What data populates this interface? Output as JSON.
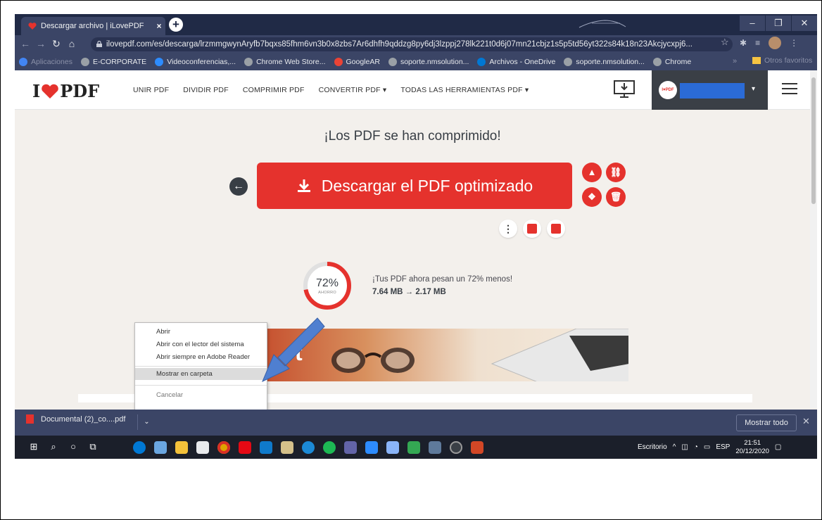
{
  "browser": {
    "tab_title": "Descargar archivo | iLovePDF",
    "tab_close": "×",
    "newtab": "+",
    "window_buttons": [
      "–",
      "❐",
      "✕"
    ],
    "url": "ilovepdf.com/es/descarga/lrzmmgwynAryfb7bqxs85fhm6vn3b0x8zbs7Ar6dhfh9qddzg8py6dj3lzppj278lk221t0d6j07mn21cbjz1s5p5td56yt322s84k18n23Akcjycxpj6..."
  },
  "bookmarks": {
    "items": [
      {
        "label": "Aplicaciones",
        "color": "#4285f4"
      },
      {
        "label": "E-CORPORATE",
        "color": "#9aa0a6"
      },
      {
        "label": "Videoconferencias,...",
        "color": "#2d8cff"
      },
      {
        "label": "Chrome Web Store...",
        "color": "#9aa0a6"
      },
      {
        "label": "GoogleAR",
        "color": "#ea4335"
      },
      {
        "label": "soporte.nmsolution...",
        "color": "#9aa0a6"
      },
      {
        "label": "Archivos - OneDrive",
        "color": "#0078d4"
      },
      {
        "label": "soporte.nmsolution...",
        "color": "#9aa0a6"
      },
      {
        "label": "Chrome",
        "color": "#9aa0a6"
      }
    ],
    "more": "»",
    "other": "Otros favoritos"
  },
  "site": {
    "logo_left": "I",
    "logo_right": "PDF",
    "nav": [
      "UNIR PDF",
      "DIVIDIR PDF",
      "COMPRIMIR PDF",
      "CONVERTIR PDF ▾",
      "TODAS LAS HERRAMIENTAS PDF ▾"
    ],
    "avatar_text": "I♥PDF",
    "user_caret": "▾"
  },
  "main": {
    "headline": "¡Los PDF se han comprimido!",
    "download_label": "Descargar el PDF optimizado",
    "back": "←",
    "more_options": "⋮",
    "ring_percent": "72%",
    "ring_fraction": 0.72,
    "ring_sub": "AHORRO",
    "result_text": "¡Tus PDF ahora pesan un 72% menos!",
    "result_size": "7.64 MB → 2.17 MB",
    "banner_letter": "t"
  },
  "context_menu": {
    "items": [
      {
        "label": "Abrir",
        "highlight": false
      },
      {
        "label": "Abrir con el lector del sistema",
        "highlight": false
      },
      {
        "label": "Abrir siempre en Adobe Reader",
        "highlight": false
      },
      {
        "label": "Mostrar en carpeta",
        "highlight": true
      },
      {
        "label": "Cancelar",
        "highlight": false
      }
    ]
  },
  "download_shelf": {
    "filename": "Documental (2)_co....pdf",
    "caret": "⌄",
    "show_all": "Mostrar todo",
    "close": "✕"
  },
  "taskbar": {
    "desktop_label": "Escritorio",
    "lang": "ESP",
    "time": "21:51",
    "date": "20/12/2020"
  }
}
